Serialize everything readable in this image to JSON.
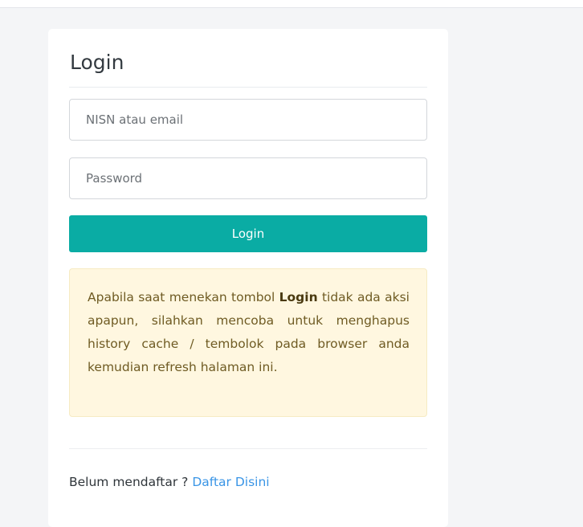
{
  "login_card": {
    "title": "Login",
    "username_placeholder": "NISN atau email",
    "password_placeholder": "Password",
    "submit_label": "Login",
    "notice": {
      "before": "Apabila saat menekan tombol ",
      "bold": "Login",
      "after": " tidak ada aksi apapun, silahkan mencoba untuk menghapus history cache / tembolok pada browser anda kemudian refresh halaman ini."
    },
    "register_prompt": "Belum mendaftar ? ",
    "register_link": "Daftar Disini"
  },
  "colors": {
    "primary_button": "#0aaca4",
    "notice_background": "#fff7e0",
    "link": "#3a95e6"
  }
}
